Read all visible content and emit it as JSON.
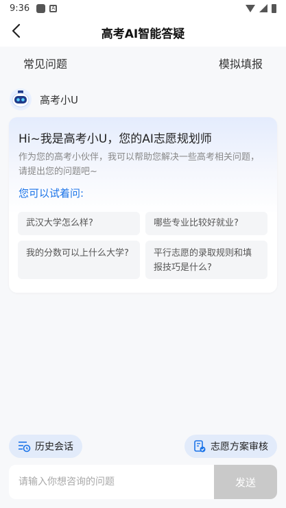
{
  "status_bar": {
    "time": "9:36",
    "notif_letter": "A"
  },
  "header": {
    "title": "高考AI智能答疑"
  },
  "tabs": {
    "left": "常见问题",
    "right": "模拟填报"
  },
  "bot": {
    "name": "高考小U"
  },
  "intro_card": {
    "greeting": "Hi~我是高考小U，您的AI志愿规划师",
    "description": "作为您的高考小伙伴，我可以帮助您解决一些高考相关问题，请提出您的问题吧~",
    "suggest_title": "您可以试着问:",
    "questions": [
      "武汉大学怎么样?",
      "哪些专业比较好就业?",
      "我的分数可以上什么大学?",
      "平行志愿的录取规则和填报技巧是什么?"
    ]
  },
  "actions": {
    "history": "历史会话",
    "review": "志愿方案审核"
  },
  "composer": {
    "placeholder": "请输入你想咨询的问题",
    "send": "发送"
  },
  "colors": {
    "accent": "#1a73e8",
    "pill_bg": "#e2ebfa",
    "send_bg": "#c9c9c9"
  }
}
